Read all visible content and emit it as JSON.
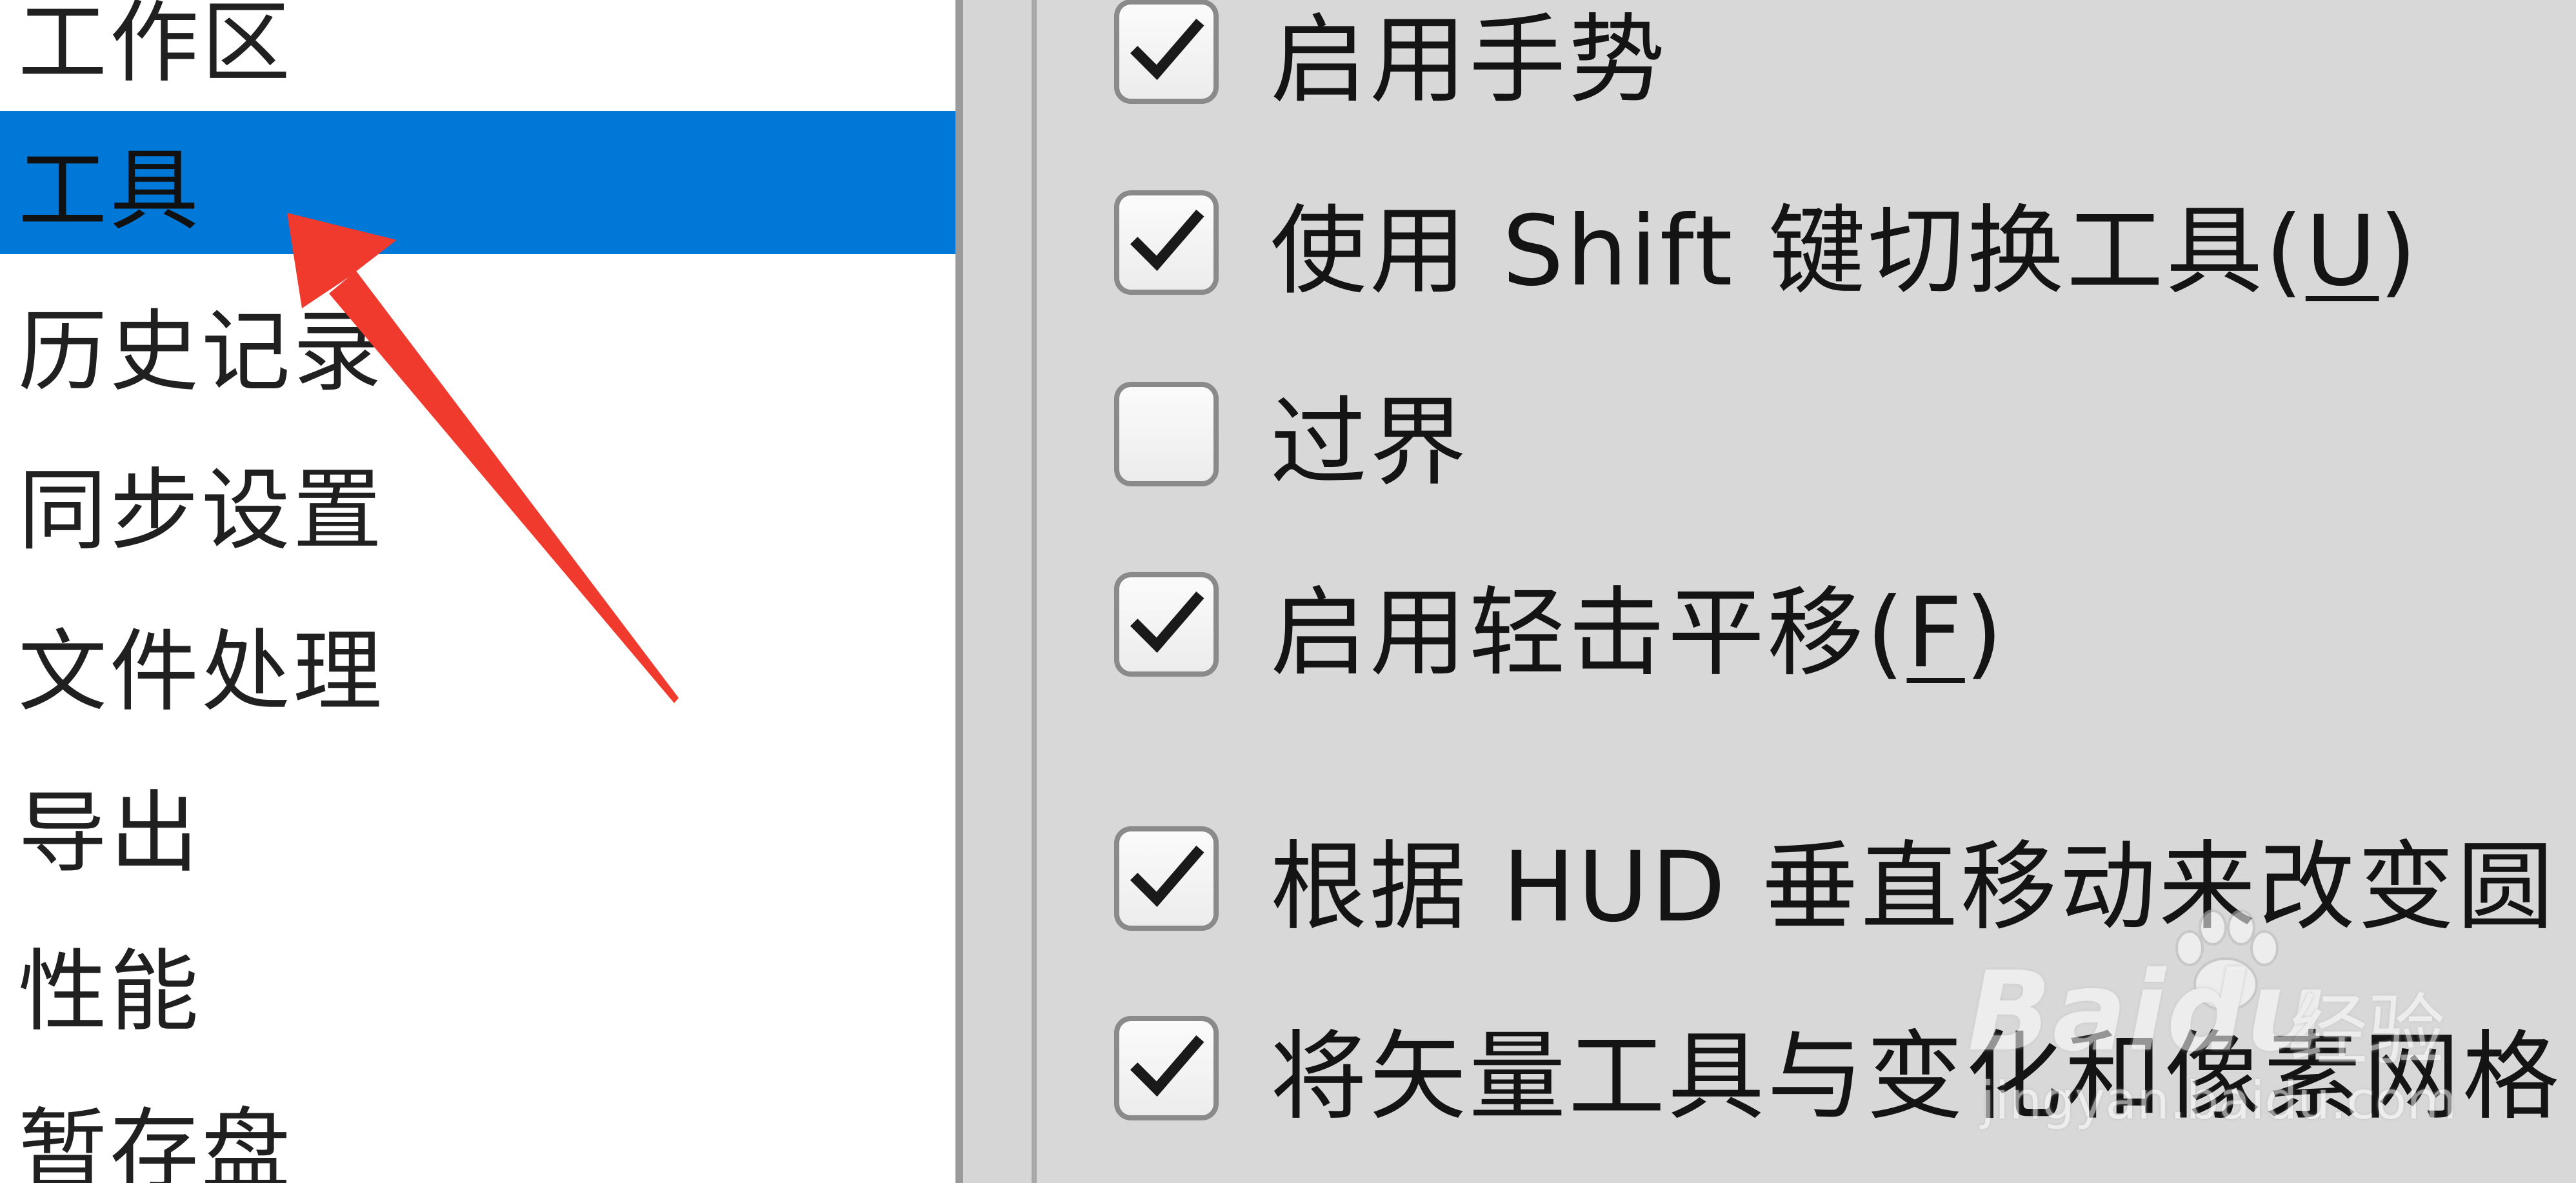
{
  "sidebar": {
    "items": [
      {
        "label": "工作区"
      },
      {
        "label": "工具"
      },
      {
        "label": "历史记录"
      },
      {
        "label": "同步设置"
      },
      {
        "label": "文件处理"
      },
      {
        "label": "导出"
      },
      {
        "label": "性能"
      },
      {
        "label": "暂存盘"
      }
    ],
    "selected_index": 1,
    "selected_color": "#0078d7"
  },
  "options": [
    {
      "label": "启用手势",
      "checked": true
    },
    {
      "label_prefix": "使用 Shift 键切换工具(",
      "mnemonic": "U",
      "label_suffix": ")",
      "checked": true
    },
    {
      "label": "过界",
      "checked": false
    },
    {
      "label_prefix": "启用轻击平移(",
      "mnemonic": "F",
      "label_suffix": ")",
      "checked": true
    },
    {
      "label": "根据 HUD 垂直移动来改变圆",
      "checked": true
    },
    {
      "label": "将矢量工具与变化和像素网格",
      "checked": true
    }
  ],
  "annotation": {
    "arrow_color": "#f03a2e",
    "icon": "red-arrow-pointer"
  },
  "watermark": {
    "brand": "Baidu",
    "sub": "经验",
    "url": "jingyan.baidu.com",
    "icon": "paw-icon"
  }
}
